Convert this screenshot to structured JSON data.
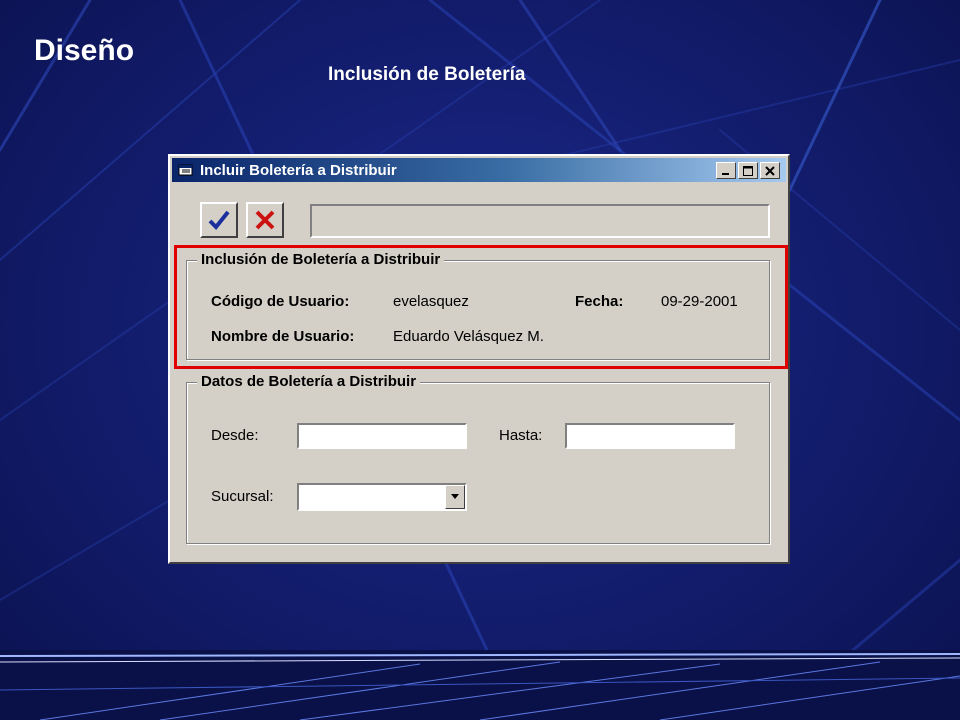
{
  "slide": {
    "title": "Diseño",
    "subtitle": "Inclusión de Boletería"
  },
  "window": {
    "title": "Incluir Boletería a Distribuir",
    "icon": "app-window-icon",
    "controls": {
      "minimize": "minimize-icon",
      "maximize": "maximize-icon",
      "close": "close-icon"
    }
  },
  "toolbar": {
    "accept_icon": "checkmark-icon",
    "cancel_icon": "x-mark-icon",
    "status_text": ""
  },
  "group_inclusion": {
    "legend": "Inclusión de Boletería a Distribuir",
    "user_code_label": "Código de Usuario:",
    "user_code_value": "evelasquez",
    "date_label": "Fecha:",
    "date_value": "09-29-2001",
    "user_name_label": "Nombre de Usuario:",
    "user_name_value": "Eduardo Velásquez M."
  },
  "group_datos": {
    "legend": "Datos de Boletería a Distribuir",
    "desde_label": "Desde:",
    "desde_value": "",
    "hasta_label": "Hasta:",
    "hasta_value": "",
    "sucursal_label": "Sucursal:",
    "sucursal_value": ""
  },
  "colors": {
    "highlight": "#e00000",
    "background": "#121c6b",
    "titlebar_start": "#0a246a",
    "window_face": "#d4d0c8"
  }
}
